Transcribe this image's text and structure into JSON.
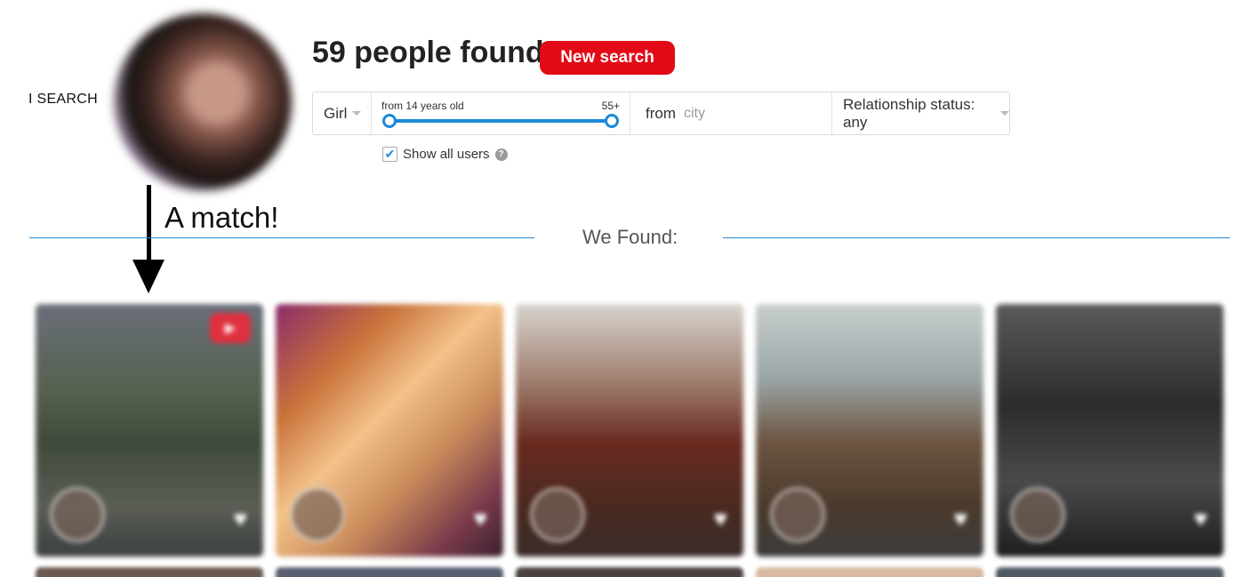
{
  "search": {
    "label": "I SEARCH",
    "results_title": "59 people found",
    "new_search_label": "New search"
  },
  "filters": {
    "gender": "Girl",
    "age_from_label": "from 14 years old",
    "age_to_label": "55+",
    "city_prefix": "from",
    "city_placeholder": "city",
    "relationship_status": "Relationship status: any",
    "show_all_users_label": "Show all users",
    "show_all_users_checked": true,
    "help_icon": "?"
  },
  "annotation": {
    "match_label": "A match!"
  },
  "results": {
    "heading": "We Found:",
    "cards": [
      {
        "video_badge": "▶"
      },
      {},
      {},
      {},
      {}
    ],
    "heart_icon": "♥"
  },
  "colors": {
    "accent_blue": "#1e88d6",
    "button_red": "#e30a17"
  }
}
